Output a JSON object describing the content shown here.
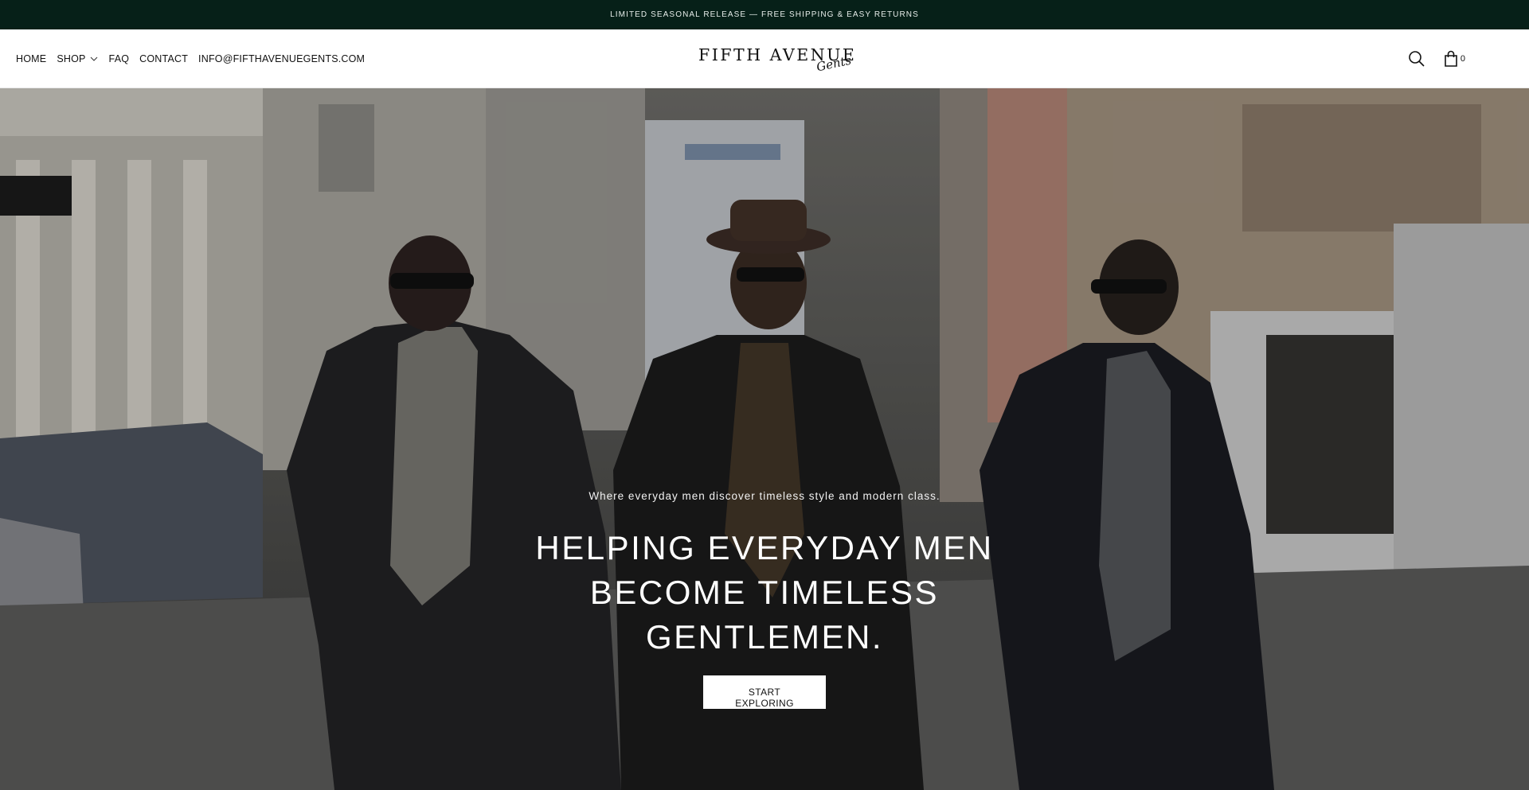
{
  "announcement": {
    "text": "LIMITED SEASONAL RELEASE — FREE SHIPPING & EASY RETURNS"
  },
  "nav": {
    "items": [
      {
        "label": "HOME"
      },
      {
        "label": "SHOP",
        "has_dropdown": true
      },
      {
        "label": "FAQ"
      },
      {
        "label": "CONTACT"
      },
      {
        "label": "INFO@FIFTHAVENUEGENTS.COM"
      }
    ]
  },
  "logo": {
    "main": "FIFTH AVENUE",
    "script": "Gents"
  },
  "header_icons": {
    "search": "search-icon",
    "cart": "shopping-bag-icon",
    "cart_count": "0"
  },
  "hero": {
    "tagline": "Where everyday men discover timeless style and modern class.",
    "headline": "HELPING EVERYDAY MEN BECOME TIMELESS GENTLEMEN.",
    "cta_label": "START EXPLORING"
  },
  "colors": {
    "announcement_bg": "#062018",
    "header_bg": "#ffffff",
    "cta_bg": "#ffffff",
    "hero_text": "#ffffff"
  }
}
